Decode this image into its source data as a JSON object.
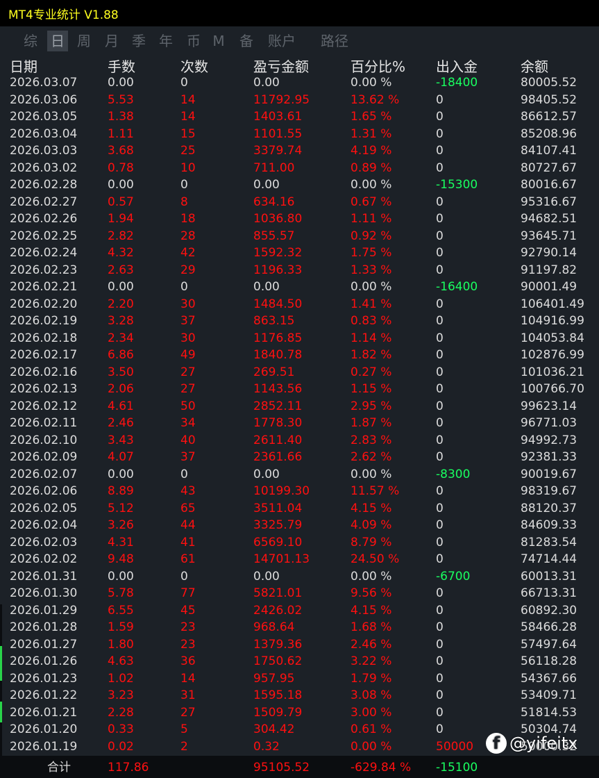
{
  "title": "MT4专业统计 V1.88",
  "tabs": [
    "综",
    "日",
    "周",
    "月",
    "季",
    "年",
    "币",
    "M",
    "备",
    "账户",
    "路径"
  ],
  "active_tab": "日",
  "headers": [
    "日期",
    "手数",
    "次数",
    "盈亏金额",
    "百分比%",
    "出入金",
    "余额"
  ],
  "rows": [
    [
      "2026.03.07",
      "0.00",
      "0",
      "0.00",
      "0.00 %",
      "-18400",
      "80005.52"
    ],
    [
      "2026.03.06",
      "5.53",
      "14",
      "11792.95",
      "13.62 %",
      "0",
      "98405.52"
    ],
    [
      "2026.03.05",
      "1.38",
      "14",
      "1403.61",
      "1.65 %",
      "0",
      "86612.57"
    ],
    [
      "2026.03.04",
      "1.11",
      "15",
      "1101.55",
      "1.31 %",
      "0",
      "85208.96"
    ],
    [
      "2026.03.03",
      "3.68",
      "25",
      "3379.74",
      "4.19 %",
      "0",
      "84107.41"
    ],
    [
      "2026.03.02",
      "0.78",
      "10",
      "711.00",
      "0.89 %",
      "0",
      "80727.67"
    ],
    [
      "2026.02.28",
      "0.00",
      "0",
      "0.00",
      "0.00 %",
      "-15300",
      "80016.67"
    ],
    [
      "2026.02.27",
      "0.57",
      "8",
      "634.16",
      "0.67 %",
      "0",
      "95316.67"
    ],
    [
      "2026.02.26",
      "1.94",
      "18",
      "1036.80",
      "1.11 %",
      "0",
      "94682.51"
    ],
    [
      "2026.02.25",
      "2.82",
      "28",
      "855.57",
      "0.92 %",
      "0",
      "93645.71"
    ],
    [
      "2026.02.24",
      "4.32",
      "42",
      "1592.32",
      "1.75 %",
      "0",
      "92790.14"
    ],
    [
      "2026.02.23",
      "2.63",
      "29",
      "1196.33",
      "1.33 %",
      "0",
      "91197.82"
    ],
    [
      "2026.02.21",
      "0.00",
      "0",
      "0.00",
      "0.00 %",
      "-16400",
      "90001.49"
    ],
    [
      "2026.02.20",
      "2.20",
      "30",
      "1484.50",
      "1.41 %",
      "0",
      "106401.49"
    ],
    [
      "2026.02.19",
      "3.28",
      "37",
      "863.15",
      "0.83 %",
      "0",
      "104916.99"
    ],
    [
      "2026.02.18",
      "2.34",
      "30",
      "1176.85",
      "1.14 %",
      "0",
      "104053.84"
    ],
    [
      "2026.02.17",
      "6.86",
      "49",
      "1840.78",
      "1.82 %",
      "0",
      "102876.99"
    ],
    [
      "2026.02.16",
      "3.50",
      "27",
      "269.51",
      "0.27 %",
      "0",
      "101036.21"
    ],
    [
      "2026.02.13",
      "2.06",
      "27",
      "1143.56",
      "1.15 %",
      "0",
      "100766.70"
    ],
    [
      "2026.02.12",
      "4.61",
      "50",
      "2852.11",
      "2.95 %",
      "0",
      "99623.14"
    ],
    [
      "2026.02.11",
      "2.46",
      "34",
      "1778.30",
      "1.87 %",
      "0",
      "96771.03"
    ],
    [
      "2026.02.10",
      "3.43",
      "40",
      "2611.40",
      "2.83 %",
      "0",
      "94992.73"
    ],
    [
      "2026.02.09",
      "4.07",
      "37",
      "2361.66",
      "2.62 %",
      "0",
      "92381.33"
    ],
    [
      "2026.02.07",
      "0.00",
      "0",
      "0.00",
      "0.00 %",
      "-8300",
      "90019.67"
    ],
    [
      "2026.02.06",
      "8.89",
      "43",
      "10199.30",
      "11.57 %",
      "0",
      "98319.67"
    ],
    [
      "2026.02.05",
      "5.12",
      "65",
      "3511.04",
      "4.15 %",
      "0",
      "88120.37"
    ],
    [
      "2026.02.04",
      "3.26",
      "44",
      "3325.79",
      "4.09 %",
      "0",
      "84609.33"
    ],
    [
      "2026.02.03",
      "4.31",
      "41",
      "6569.10",
      "8.79 %",
      "0",
      "81283.54"
    ],
    [
      "2026.02.02",
      "9.48",
      "61",
      "14701.13",
      "24.50 %",
      "0",
      "74714.44"
    ],
    [
      "2026.01.31",
      "0.00",
      "0",
      "0.00",
      "0.00 %",
      "-6700",
      "60013.31"
    ],
    [
      "2026.01.30",
      "5.78",
      "77",
      "5821.01",
      "9.56 %",
      "0",
      "66713.31"
    ],
    [
      "2026.01.29",
      "6.55",
      "45",
      "2426.02",
      "4.15 %",
      "0",
      "60892.30"
    ],
    [
      "2026.01.28",
      "1.59",
      "23",
      "968.64",
      "1.68 %",
      "0",
      "58466.28"
    ],
    [
      "2026.01.27",
      "1.80",
      "23",
      "1379.36",
      "2.46 %",
      "0",
      "57497.64"
    ],
    [
      "2026.01.26",
      "4.63",
      "36",
      "1750.62",
      "3.22 %",
      "0",
      "56118.28"
    ],
    [
      "2026.01.23",
      "1.02",
      "14",
      "957.95",
      "1.79 %",
      "0",
      "54367.66"
    ],
    [
      "2026.01.22",
      "3.23",
      "31",
      "1595.18",
      "3.08 %",
      "0",
      "53409.71"
    ],
    [
      "2026.01.21",
      "2.28",
      "27",
      "1509.79",
      "3.00 %",
      "0",
      "51814.53"
    ],
    [
      "2026.01.20",
      "0.33",
      "5",
      "304.42",
      "0.61 %",
      "0",
      "50304.74"
    ],
    [
      "2026.01.19",
      "0.02",
      "2",
      "0.32",
      "0.00 %",
      "50000",
      "50000.32"
    ]
  ],
  "footer": {
    "label": "合计",
    "lots": "117.86",
    "profit": "95105.52",
    "percent": "-629.84 %",
    "deposit": "-15100"
  },
  "watermark": "@yifeitx",
  "colors": {
    "positive": "#ff1010",
    "neutral": "#dcdcdc",
    "withdrawal": "#19ff60",
    "deposit": "#ff1010",
    "title": "#ffff1f"
  }
}
